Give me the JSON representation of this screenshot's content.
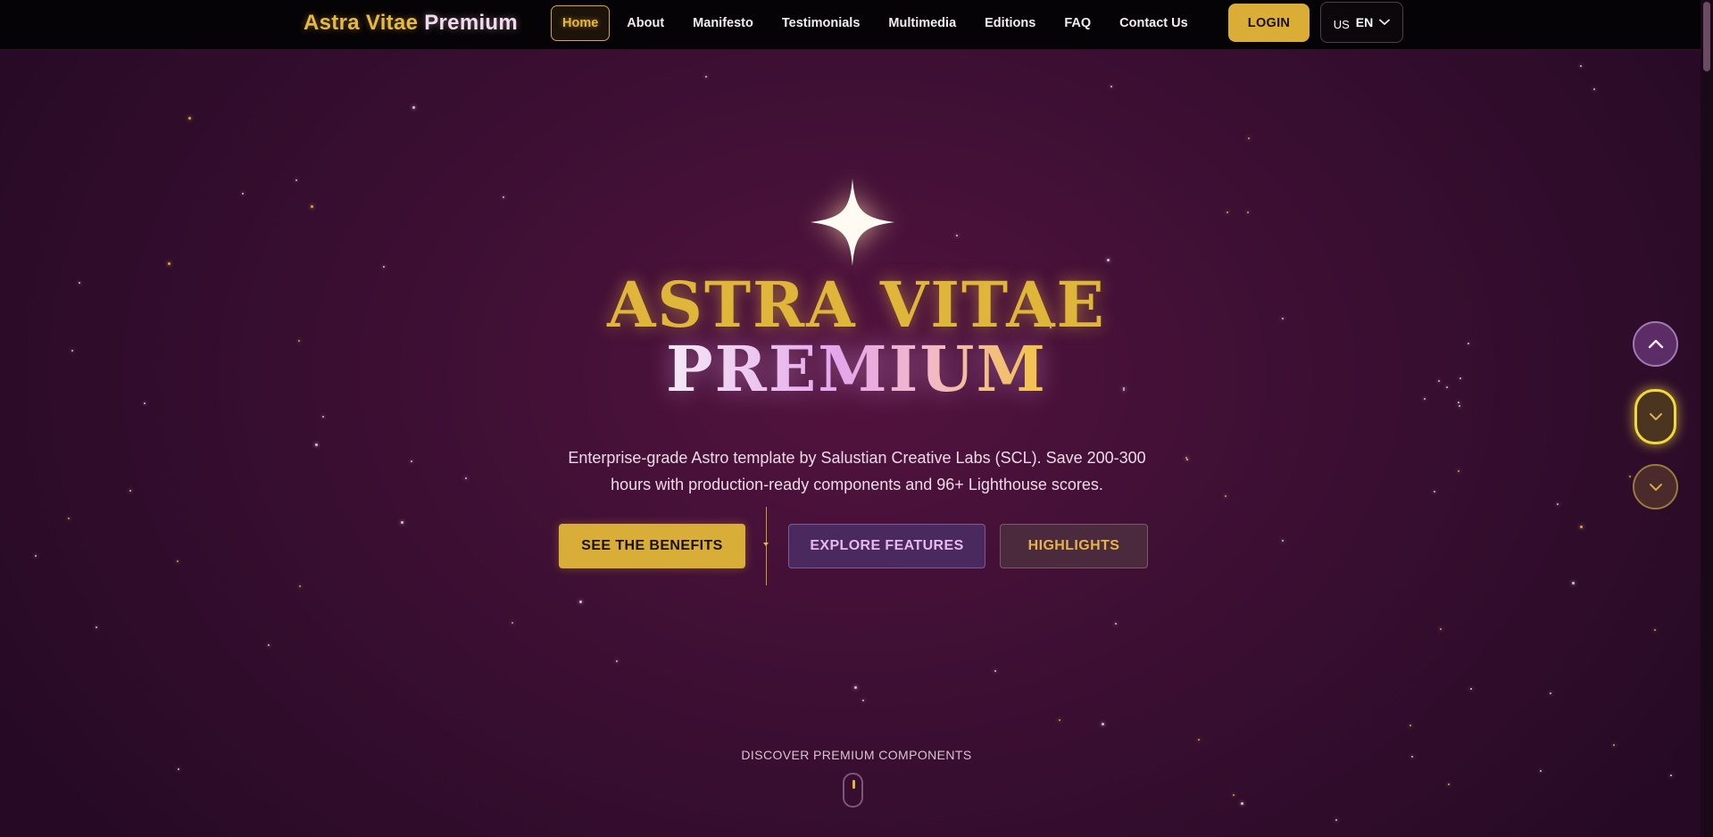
{
  "nav": {
    "brand_part1": "Astra Vitae",
    "brand_part2": "Premium",
    "items": [
      {
        "label": "Home",
        "active": true
      },
      {
        "label": "About"
      },
      {
        "label": "Manifesto"
      },
      {
        "label": "Testimonials"
      },
      {
        "label": "Multimedia"
      },
      {
        "label": "Editions"
      },
      {
        "label": "FAQ"
      },
      {
        "label": "Contact Us"
      }
    ],
    "login_label": "LOGIN",
    "language": {
      "flag": "US",
      "code": "EN"
    }
  },
  "hero": {
    "icon": "sparkle-star-icon",
    "title_line1": "ASTRA VITAE",
    "title_line2": "PREMIUM",
    "subtitle": "Enterprise-grade Astro template by Salustian Creative Labs (SCL). Save 200-300 hours with production-ready components and 96+ Lighthouse scores.",
    "buttons": {
      "benefits": "SEE THE BENEFITS",
      "features": "EXPLORE FEATURES",
      "highlights": "HIGHLIGHTS"
    }
  },
  "side_controls": [
    "chevron-up-icon",
    "chevron-down-icon",
    "chevron-down-icon"
  ],
  "discover_label": "DISCOVER PREMIUM COMPONENTS",
  "colors": {
    "gold": "#d9ad36",
    "background": "#3d0f33",
    "nav_background": "#060306",
    "accent_purple": "#e8b8f2"
  }
}
